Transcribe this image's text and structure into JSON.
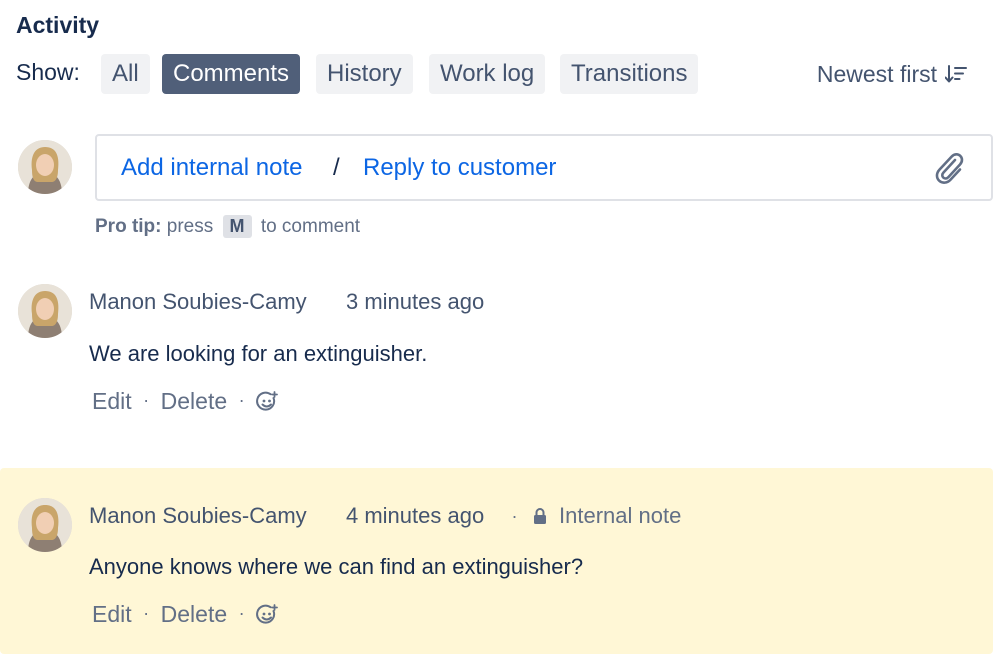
{
  "activity": {
    "title": "Activity",
    "show_label": "Show:",
    "filters": [
      {
        "label": "All",
        "active": false
      },
      {
        "label": "Comments",
        "active": true
      },
      {
        "label": "History",
        "active": false
      },
      {
        "label": "Work log",
        "active": false
      },
      {
        "label": "Transitions",
        "active": false
      }
    ],
    "sort_label": "Newest first",
    "sort_icon": "sort-descending-icon"
  },
  "composer": {
    "add_internal_note": "Add internal note",
    "separator": "/",
    "reply_to_customer": "Reply to customer",
    "attach_icon": "paperclip-icon"
  },
  "protip": {
    "label": "Pro tip:",
    "text_before": "press",
    "key": "M",
    "text_after": "to comment"
  },
  "comments": [
    {
      "author": "Manon Soubies-Camy",
      "time": "3 minutes ago",
      "body": "We are looking for an extinguisher.",
      "internal": false,
      "edit": "Edit",
      "delete": "Delete"
    },
    {
      "author": "Manon Soubies-Camy",
      "time": "4 minutes ago",
      "body": "Anyone knows where we can find an extinguisher?",
      "internal": true,
      "internal_label": "Internal note",
      "edit": "Edit",
      "delete": "Delete"
    }
  ],
  "colors": {
    "link": "#0c66e4",
    "active_filter_bg": "#505f79",
    "internal_note_bg": "#fff7d6"
  }
}
